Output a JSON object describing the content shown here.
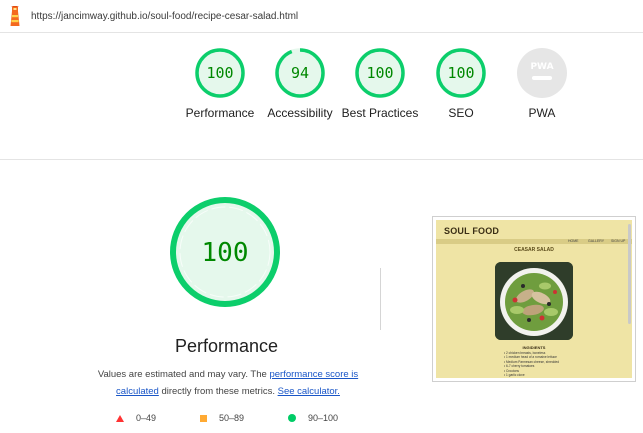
{
  "url": {
    "text": "https://jancimway.github.io/soul-food/recipe-cesar-salad.html",
    "icon": "lighthouse-icon"
  },
  "colors": {
    "pass": "#0cce6b",
    "pass_text": "#008800",
    "pass_fill": "#e5f8ec",
    "average": "#ffa400",
    "fail": "#ff3333",
    "na": "#c4c4c4",
    "link": "#1a56c7"
  },
  "categories": [
    {
      "score": "100",
      "label": "Performance",
      "value": 1.0
    },
    {
      "score": "94",
      "label": "Accessibility",
      "value": 0.94
    },
    {
      "score": "100",
      "label": "Best Practices",
      "value": 1.0
    },
    {
      "score": "100",
      "label": "SEO",
      "value": 1.0
    },
    {
      "score": "PWA",
      "label": "PWA",
      "value": null
    }
  ],
  "main": {
    "score": "100",
    "value": 1.0,
    "title": "Performance",
    "desc_prefix": "Values are estimated and may vary. The",
    "desc_link1": "performance score is calculated",
    "desc_mid": "directly from these metrics.",
    "desc_link2": "See calculator."
  },
  "legend": [
    {
      "range": "0–49",
      "icon": "triangle-icon"
    },
    {
      "range": "50–89",
      "icon": "square-icon"
    },
    {
      "range": "90–100",
      "icon": "circle-icon"
    }
  ],
  "thumbnail": {
    "brand": "SOUL FOOD",
    "nav": [
      "HOME",
      "GALLERY",
      "SIGN UP"
    ],
    "heading": "CEASAR SALAD",
    "ingredients_heading": "INGIDIENTS",
    "ingredients": [
      "2 chicken breasts, boneless",
      "1 medium head of a romaine lettuce",
      "Medium Parmesan cheese, shredded",
      "6-7 cherry tomatoes",
      "Croutons",
      "1 garlic clove"
    ]
  }
}
